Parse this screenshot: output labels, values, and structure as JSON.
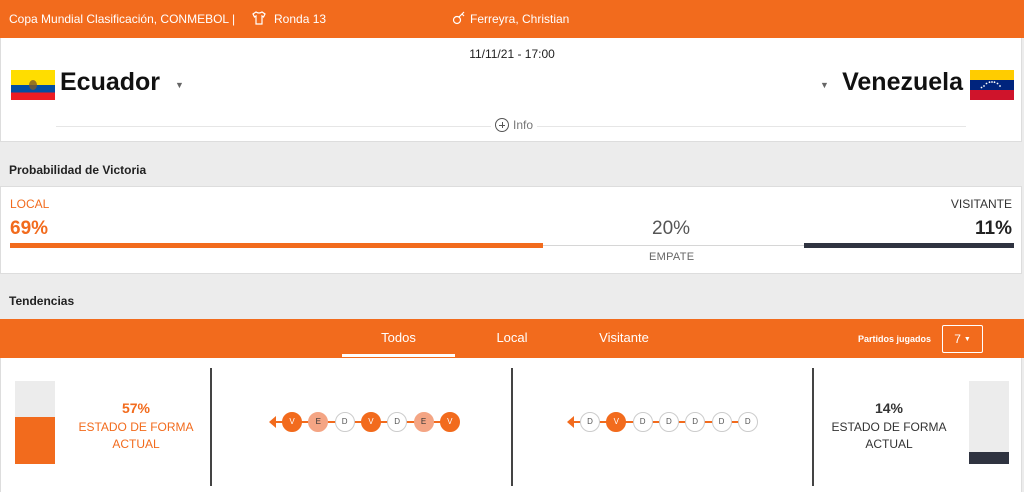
{
  "header": {
    "competition": "Copa Mundial Clasificación, CONMEBOL |",
    "round": "Ronda 13",
    "referee": "Ferreyra, Christian",
    "shirt_icon": "shirt-icon",
    "whistle_icon": "whistle-icon"
  },
  "match": {
    "datetime": "11/11/21 - 17:00",
    "home": {
      "name": "Ecuador",
      "flag": "ecuador-flag"
    },
    "away": {
      "name": "Venezuela",
      "flag": "venezuela-flag"
    },
    "info_label": "Info"
  },
  "win_probability": {
    "title": "Probabilidad de Victoria",
    "local_label": "LOCAL",
    "local_pct": "69%",
    "local_value": 0.69,
    "draw_pct": "20%",
    "draw_value": 0.2,
    "draw_label": "EMPATE",
    "away_label": "VISITANTE",
    "away_pct": "11%",
    "away_value": 0.11
  },
  "trends": {
    "title": "Tendencias",
    "tabs": [
      {
        "label": "Todos",
        "active": true
      },
      {
        "label": "Local",
        "active": false
      },
      {
        "label": "Visitante",
        "active": false
      }
    ],
    "matches_played_label": "Partidos jugados",
    "matches_played_value": "7",
    "home": {
      "form_pct": "57%",
      "form_value": 0.57,
      "form_label_1": "ESTADO DE FORMA",
      "form_label_2": "ACTUAL",
      "results": [
        "V",
        "E",
        "D",
        "V",
        "D",
        "E",
        "V"
      ]
    },
    "away": {
      "form_pct": "14%",
      "form_value": 0.14,
      "form_label_1": "ESTADO DE FORMA",
      "form_label_2": "ACTUAL",
      "results": [
        "D",
        "V",
        "D",
        "D",
        "D",
        "D",
        "D"
      ]
    }
  },
  "colors": {
    "accent": "#f26b1d",
    "dark": "#2f3340",
    "draw": "#f4a584"
  }
}
